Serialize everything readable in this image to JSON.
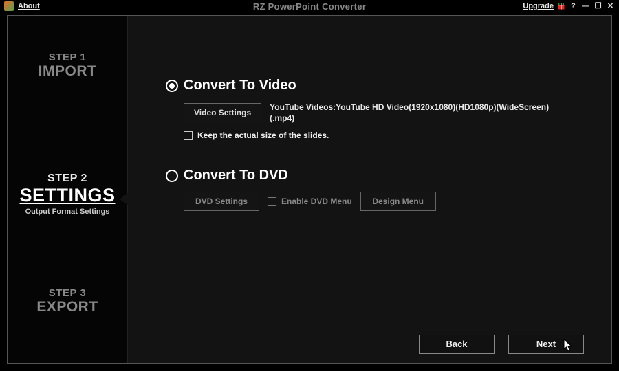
{
  "titlebar": {
    "about": "About",
    "title": "RZ PowerPoint Converter",
    "upgrade": "Upgrade"
  },
  "sidebar": {
    "step1": {
      "num": "STEP 1",
      "name": "IMPORT"
    },
    "step2": {
      "num": "STEP 2",
      "name": "SETTINGS",
      "sub": "Output Format Settings"
    },
    "step3": {
      "num": "STEP 3",
      "name": "EXPORT"
    }
  },
  "video": {
    "title": "Convert To Video",
    "settings_btn": "Video Settings",
    "preset": "YouTube Videos:YouTube HD Video(1920x1080)(HD1080p)(WideScreen)(.mp4)",
    "keep_size": "Keep the actual size of the slides."
  },
  "dvd": {
    "title": "Convert To DVD",
    "settings_btn": "DVD Settings",
    "enable_menu": "Enable DVD Menu",
    "design_btn": "Design Menu"
  },
  "footer": {
    "back": "Back",
    "next": "Next"
  }
}
